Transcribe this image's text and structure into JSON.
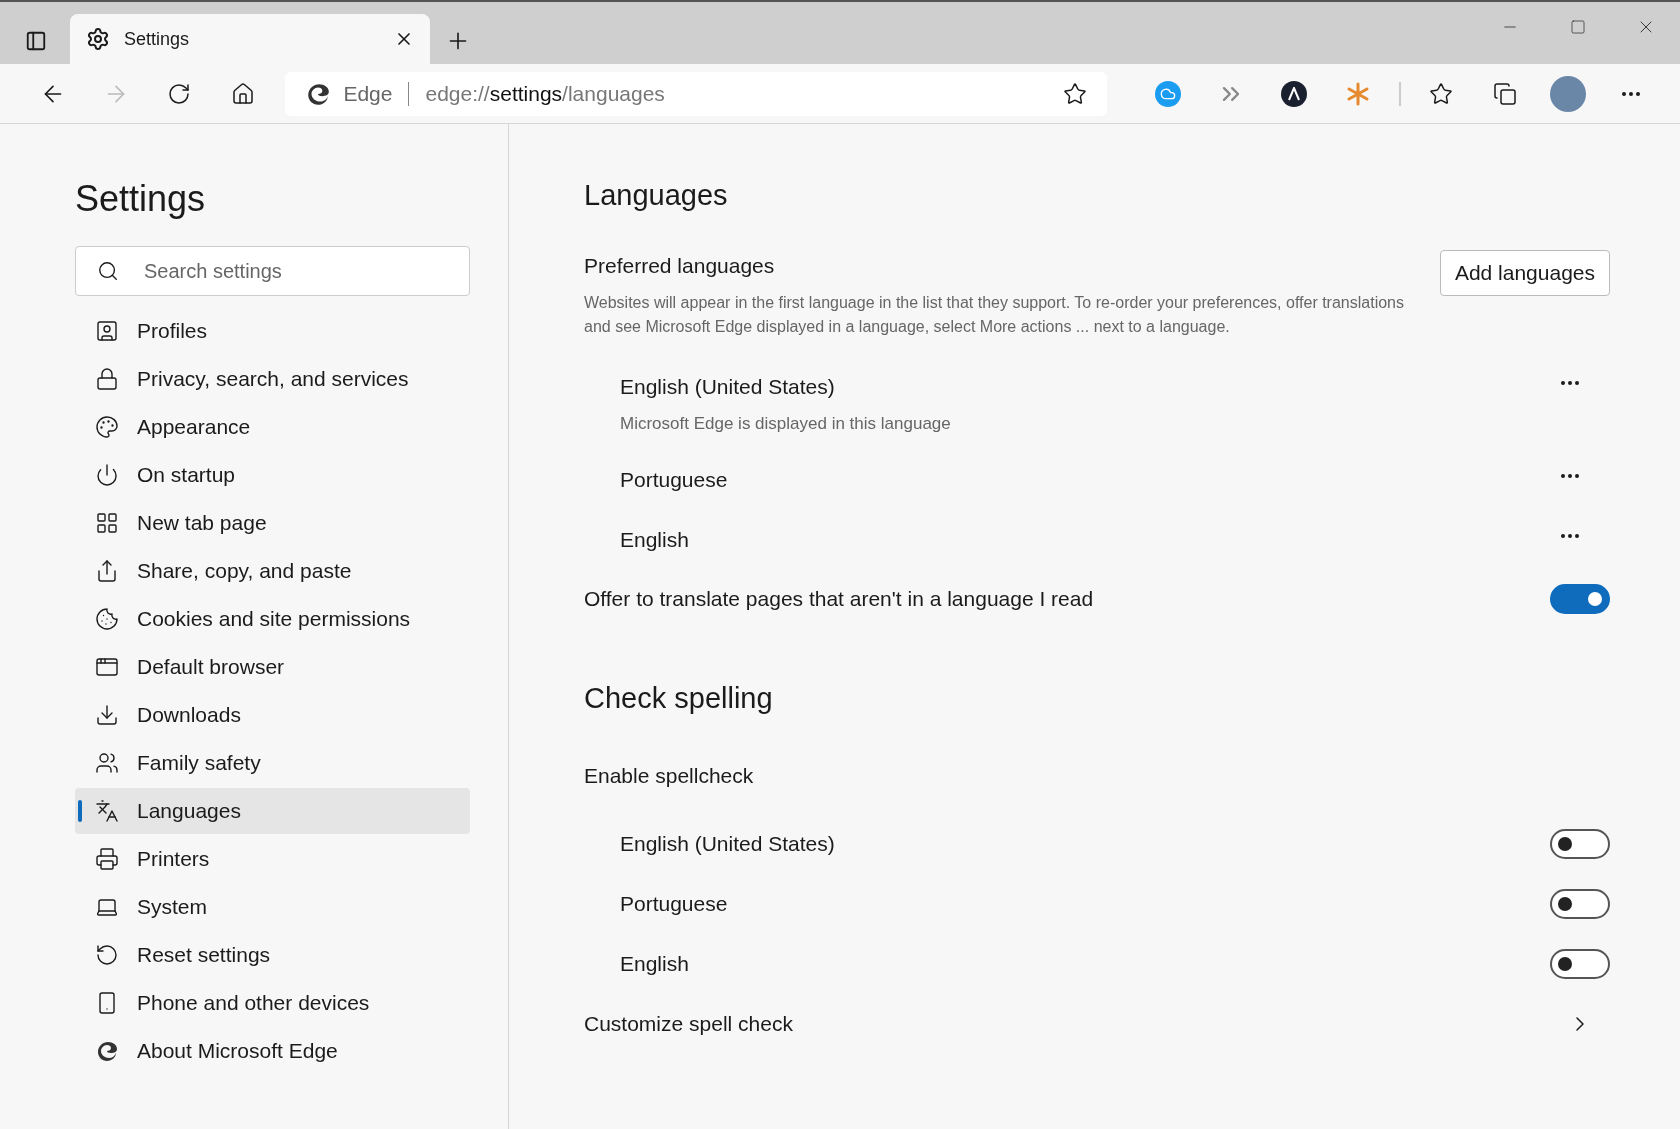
{
  "browser": {
    "tab_title": "Settings",
    "site_label": "Edge",
    "address": {
      "scheme": "edge://",
      "host": "settings",
      "path": "/languages"
    }
  },
  "sidebar": {
    "title": "Settings",
    "search": {
      "placeholder": "Search settings"
    },
    "items": [
      {
        "label": "Profiles",
        "selected": false
      },
      {
        "label": "Privacy, search, and services",
        "selected": false
      },
      {
        "label": "Appearance",
        "selected": false
      },
      {
        "label": "On startup",
        "selected": false
      },
      {
        "label": "New tab page",
        "selected": false
      },
      {
        "label": "Share, copy, and paste",
        "selected": false
      },
      {
        "label": "Cookies and site permissions",
        "selected": false
      },
      {
        "label": "Default browser",
        "selected": false
      },
      {
        "label": "Downloads",
        "selected": false
      },
      {
        "label": "Family safety",
        "selected": false
      },
      {
        "label": "Languages",
        "selected": true
      },
      {
        "label": "Printers",
        "selected": false
      },
      {
        "label": "System",
        "selected": false
      },
      {
        "label": "Reset settings",
        "selected": false
      },
      {
        "label": "Phone and other devices",
        "selected": false
      },
      {
        "label": "About Microsoft Edge",
        "selected": false
      }
    ]
  },
  "languages": {
    "title": "Languages",
    "preferred": {
      "title": "Preferred languages",
      "description": "Websites will appear in the first language in the list that they support. To re-order your preferences, offer translations and see Microsoft Edge displayed in a language, select More actions ... next to a language.",
      "button": "Add languages",
      "items": [
        {
          "name": "English (United States)",
          "note": "Microsoft Edge is displayed in this language"
        },
        {
          "name": "Portuguese"
        },
        {
          "name": "English"
        }
      ]
    },
    "translate": {
      "label": "Offer to translate pages that aren't in a language I read",
      "on": true
    }
  },
  "spelling": {
    "title": "Check spelling",
    "subtitle": "Enable spellcheck",
    "items": [
      {
        "name": "English (United States)",
        "on": false
      },
      {
        "name": "Portuguese",
        "on": false
      },
      {
        "name": "English",
        "on": false
      }
    ],
    "customize": "Customize spell check"
  }
}
